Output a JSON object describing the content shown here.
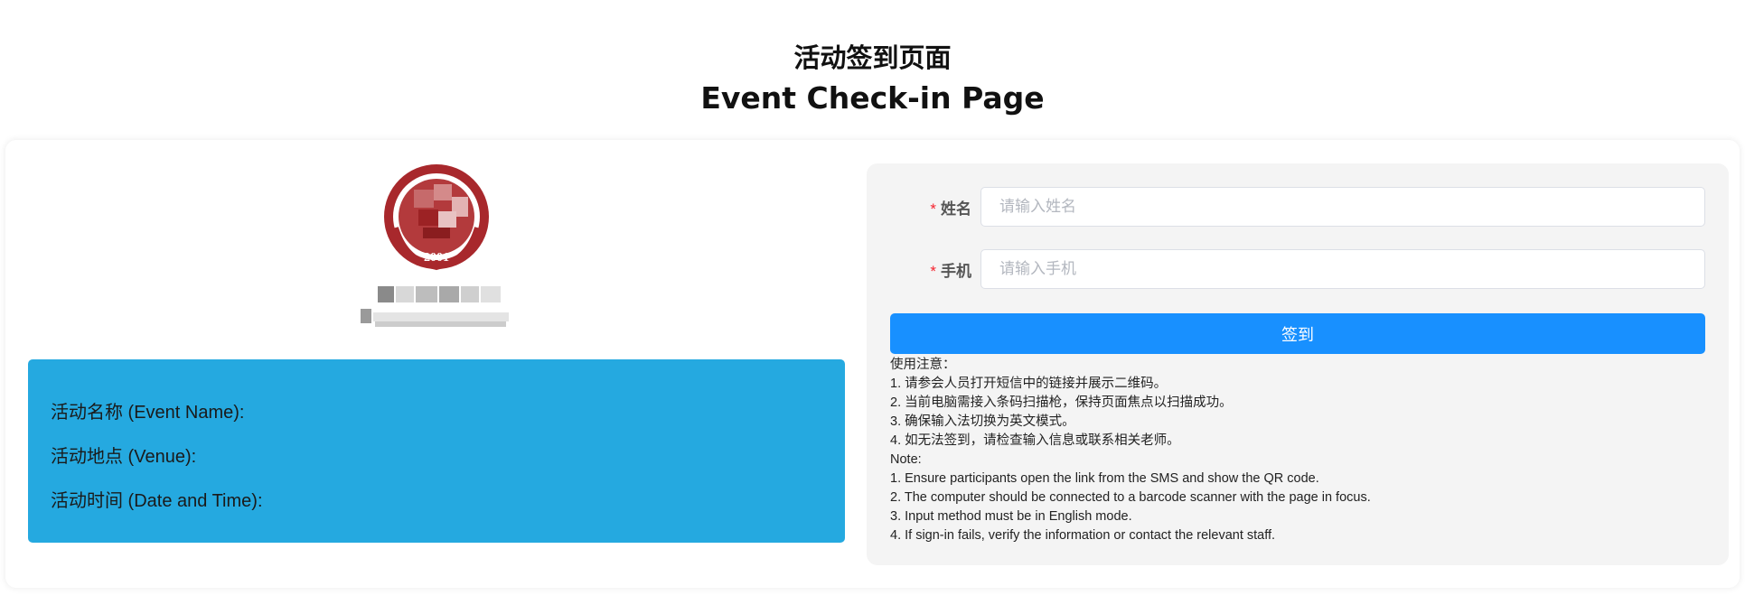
{
  "header": {
    "title_cn": "活动签到页面",
    "title_en": "Event Check-in Page"
  },
  "logo": {
    "year_text": "2001",
    "icon": "school-emblem-icon",
    "colors": {
      "primary": "#a8282c",
      "ring": "#ffffff"
    }
  },
  "event_info": {
    "name_label": "活动名称 (Event Name):",
    "venue_label": "活动地点 (Venue):",
    "time_label": "活动时间 (Date and Time):",
    "bg_color": "#25a9e0"
  },
  "form": {
    "name_label": "姓名",
    "name_placeholder": "请输入姓名",
    "name_value": "",
    "phone_label": "手机",
    "phone_placeholder": "请输入手机",
    "phone_value": "",
    "required_mark": "*",
    "submit_label": "签到",
    "submit_color": "#1890ff"
  },
  "notes": [
    "使用注意：",
    "1. 请参会人员打开短信中的链接并展示二维码。",
    "2. 当前电脑需接入条码扫描枪，保持页面焦点以扫描成功。",
    "3. 确保输入法切换为英文模式。",
    "4. 如无法签到，请检查输入信息或联系相关老师。",
    "Note:",
    "1. Ensure participants open the link from the SMS and show the QR code.",
    "2. The computer should be connected to a barcode scanner with the page in focus.",
    "3. Input method must be in English mode.",
    "4. If sign-in fails, verify the information or contact the relevant staff."
  ]
}
